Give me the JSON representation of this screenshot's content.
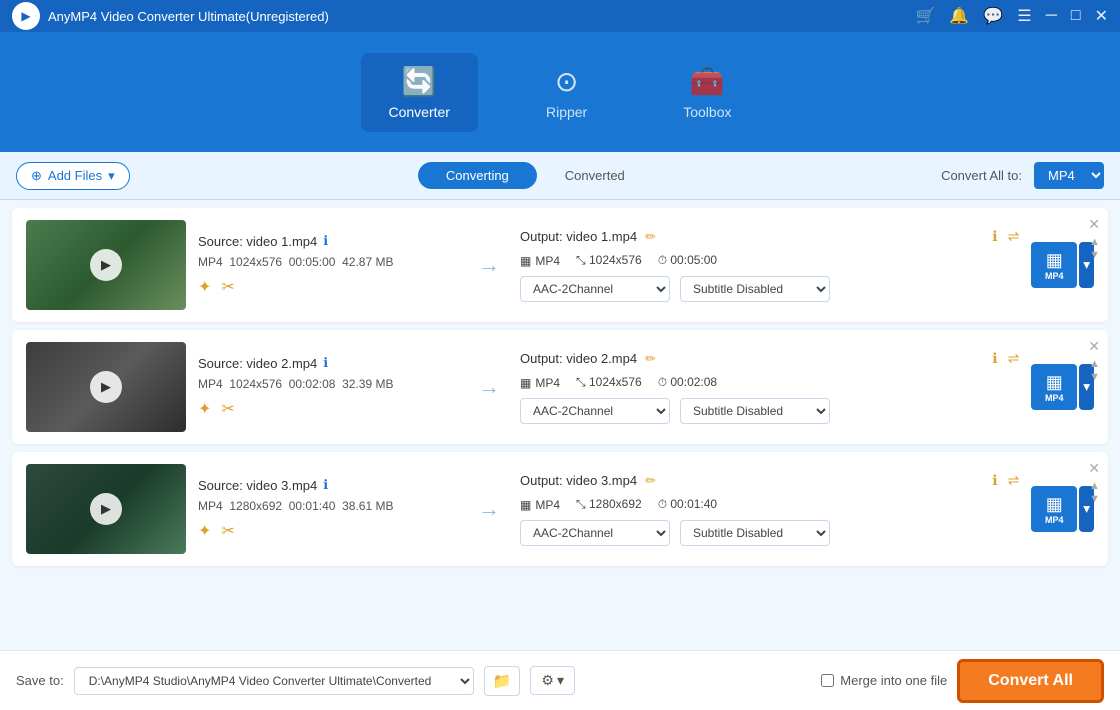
{
  "app": {
    "title": "AnyMP4 Video Converter Ultimate(Unregistered)",
    "logo_symbol": "▶"
  },
  "titlebar": {
    "cart_icon": "🛒",
    "user_icon": "🔔",
    "chat_icon": "💬",
    "menu_icon": "☰",
    "min_icon": "─",
    "max_icon": "□",
    "close_icon": "✕"
  },
  "nav": {
    "items": [
      {
        "id": "converter",
        "label": "Converter",
        "icon": "🔄",
        "active": true
      },
      {
        "id": "ripper",
        "label": "Ripper",
        "icon": "⊙"
      },
      {
        "id": "toolbox",
        "label": "Toolbox",
        "icon": "🧰"
      }
    ]
  },
  "toolbar": {
    "add_files_label": "Add Files",
    "tabs": [
      {
        "id": "converting",
        "label": "Converting",
        "active": true
      },
      {
        "id": "converted",
        "label": "Converted",
        "active": false
      }
    ],
    "convert_all_to_label": "Convert All to:",
    "convert_format": "MP4"
  },
  "files": [
    {
      "id": 1,
      "source_label": "Source: video 1.mp4",
      "format": "MP4",
      "resolution": "1024x576",
      "duration": "00:05:00",
      "size": "42.87 MB",
      "output_label": "Output: video 1.mp4",
      "out_format": "MP4",
      "out_resolution": "1024x576",
      "out_duration": "00:05:00",
      "audio": "AAC-2Channel",
      "subtitle": "Subtitle Disabled",
      "thumb_class": "file-thumb-bg1"
    },
    {
      "id": 2,
      "source_label": "Source: video 2.mp4",
      "format": "MP4",
      "resolution": "1024x576",
      "duration": "00:02:08",
      "size": "32.39 MB",
      "output_label": "Output: video 2.mp4",
      "out_format": "MP4",
      "out_resolution": "1024x576",
      "out_duration": "00:02:08",
      "audio": "AAC-2Channel",
      "subtitle": "Subtitle Disabled",
      "thumb_class": "file-thumb-bg2"
    },
    {
      "id": 3,
      "source_label": "Source: video 3.mp4",
      "format": "MP4",
      "resolution": "1280x692",
      "duration": "00:01:40",
      "size": "38.61 MB",
      "output_label": "Output: video 3.mp4",
      "out_format": "MP4",
      "out_resolution": "1280x692",
      "out_duration": "00:01:40",
      "audio": "AAC-2Channel",
      "subtitle": "Subtitle Disabled",
      "thumb_class": "file-thumb-bg3"
    }
  ],
  "bottom": {
    "save_to_label": "Save to:",
    "save_path": "D:\\AnyMP4 Studio\\AnyMP4 Video Converter Ultimate\\Converted",
    "merge_label": "Merge into one file",
    "convert_all_label": "Convert All"
  }
}
